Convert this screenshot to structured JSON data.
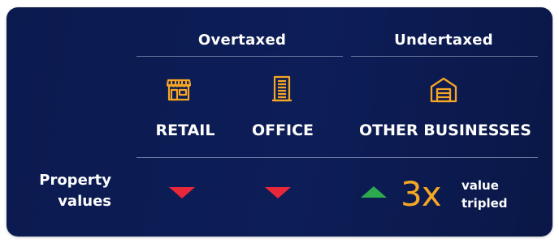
{
  "groups": {
    "overtaxed": "Overtaxed",
    "undertaxed": "Undertaxed"
  },
  "categories": {
    "retail": {
      "label": "RETAIL",
      "icon": "storefront-icon"
    },
    "office": {
      "label": "OFFICE",
      "icon": "office-building-icon"
    },
    "other": {
      "label": "OTHER BUSINESSES",
      "icon": "warehouse-icon"
    }
  },
  "row": {
    "label_line1": "Property",
    "label_line2": "values"
  },
  "changes": {
    "retail": {
      "direction": "down",
      "icon": "down-triangle-icon"
    },
    "office": {
      "direction": "down",
      "icon": "down-triangle-icon"
    },
    "other": {
      "direction": "up",
      "icon": "up-triangle-icon",
      "multiplier": "3x",
      "note_line1": "value",
      "note_line2": "tripled"
    }
  },
  "colors": {
    "background": "#0b1a4f",
    "accent_icon": "#f5a623",
    "down": "#e8283a",
    "up": "#2eaa4e"
  }
}
